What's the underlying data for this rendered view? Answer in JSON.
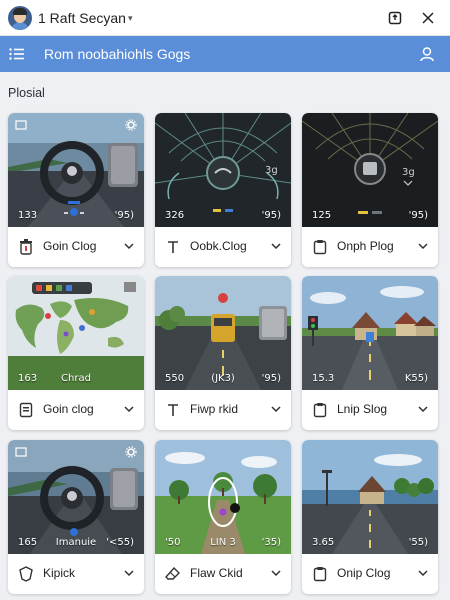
{
  "window": {
    "title": "1 Raft Secyan",
    "avatar_icon": "user-avatar",
    "share_icon": "share-icon",
    "close_icon": "close-icon"
  },
  "toolbar": {
    "title": "Rom noobahiohls Gogs",
    "menu_icon": "hamburger-menu-icon",
    "user_icon": "user-icon",
    "accent": "#5b8ed8"
  },
  "section": {
    "label": "Plosial"
  },
  "cards": [
    {
      "label": "Goin Clog",
      "icon": "trash-icon",
      "scene": "steering-wheel",
      "stats": [
        "133",
        "",
        "ꞌ95)"
      ]
    },
    {
      "label": "Oobk.Clog",
      "icon": "text-tool-icon",
      "scene": "radar-dashboard",
      "stats": [
        "326",
        "",
        "ꞌ95)"
      ]
    },
    {
      "label": "Onph Plog",
      "icon": "clipboard-icon",
      "scene": "dark-dashboard",
      "stats": [
        "125",
        "",
        "ꞌ95)"
      ]
    },
    {
      "label": "Goin clog",
      "icon": "document-icon",
      "scene": "world-map",
      "stats": [
        "163",
        "Chrad",
        ""
      ]
    },
    {
      "label": "Fiwp rkid",
      "icon": "text-tool-icon",
      "scene": "road-vehicle",
      "stats": [
        "550",
        "(JK3)",
        "ꞌ95)"
      ]
    },
    {
      "label": "Lnip Slog",
      "icon": "clipboard-icon",
      "scene": "village-road",
      "stats": [
        "15.3",
        "",
        "K55)"
      ]
    },
    {
      "label": "Kipick",
      "icon": "shield-icon",
      "scene": "steering-wheel-2",
      "stats": [
        "165",
        "Imanuie",
        "ꞌ<55)"
      ]
    },
    {
      "label": "Flaw Ckid",
      "icon": "eraser-icon",
      "scene": "field-path",
      "stats": [
        "ꞌ50",
        "LIN 3",
        "ꞌ35)"
      ]
    },
    {
      "label": "Onip Clog",
      "icon": "clipboard-icon",
      "scene": "lake-village",
      "stats": [
        "3.65",
        "",
        "ꞌ55)"
      ]
    }
  ]
}
